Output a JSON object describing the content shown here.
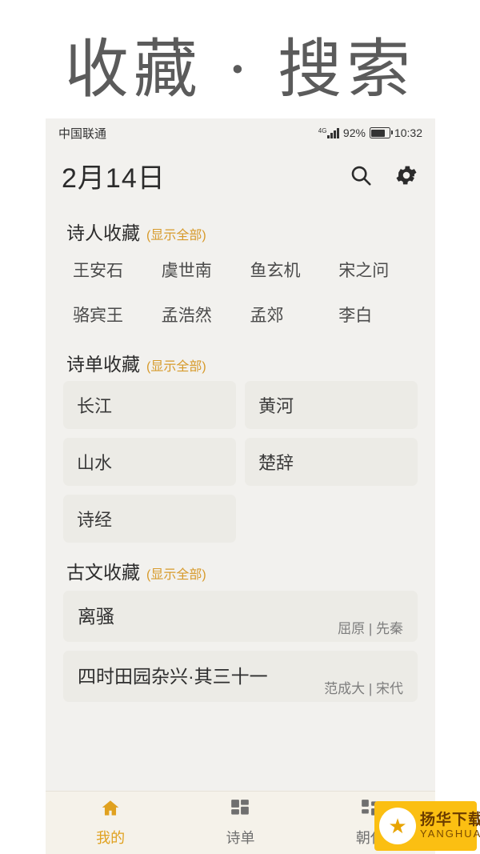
{
  "headline": "收藏 · 搜索",
  "status_bar": {
    "carrier": "中国联通",
    "network": "4G",
    "battery": "92%",
    "time": "10:32"
  },
  "app_bar": {
    "title": "2月14日",
    "search_icon": "search-icon",
    "settings_icon": "gear-icon"
  },
  "sections": [
    {
      "title": "诗人收藏",
      "more": "(显示全部)",
      "poets": [
        "王安石",
        "虞世南",
        "鱼玄机",
        "宋之问",
        "骆宾王",
        "孟浩然",
        "孟郊",
        "李白"
      ]
    },
    {
      "title": "诗单收藏",
      "more": "(显示全部)",
      "cards": [
        "长江",
        "黄河",
        "山水",
        "楚辞",
        "诗经"
      ]
    },
    {
      "title": "古文收藏",
      "more": "(显示全部)",
      "classics": [
        {
          "title": "离骚",
          "meta": "屈原 | 先秦"
        },
        {
          "title": "四时田园杂兴·其三十一",
          "meta": "范成大 | 宋代"
        }
      ]
    }
  ],
  "bottom_nav": [
    {
      "label": "我的",
      "icon": "home-icon",
      "active": true
    },
    {
      "label": "诗单",
      "icon": "grid-icon",
      "active": false
    },
    {
      "label": "朝代",
      "icon": "blocks-icon",
      "active": false
    }
  ],
  "watermark": {
    "main": "扬华下载",
    "sub": "YANGHUA.NET"
  },
  "colors": {
    "accent": "#d79a2b",
    "nav_active": "#e0a11f",
    "page_bg": "#f2f1ee",
    "card_bg": "#ecebe6",
    "watermark_bg": "#fbbf12"
  }
}
